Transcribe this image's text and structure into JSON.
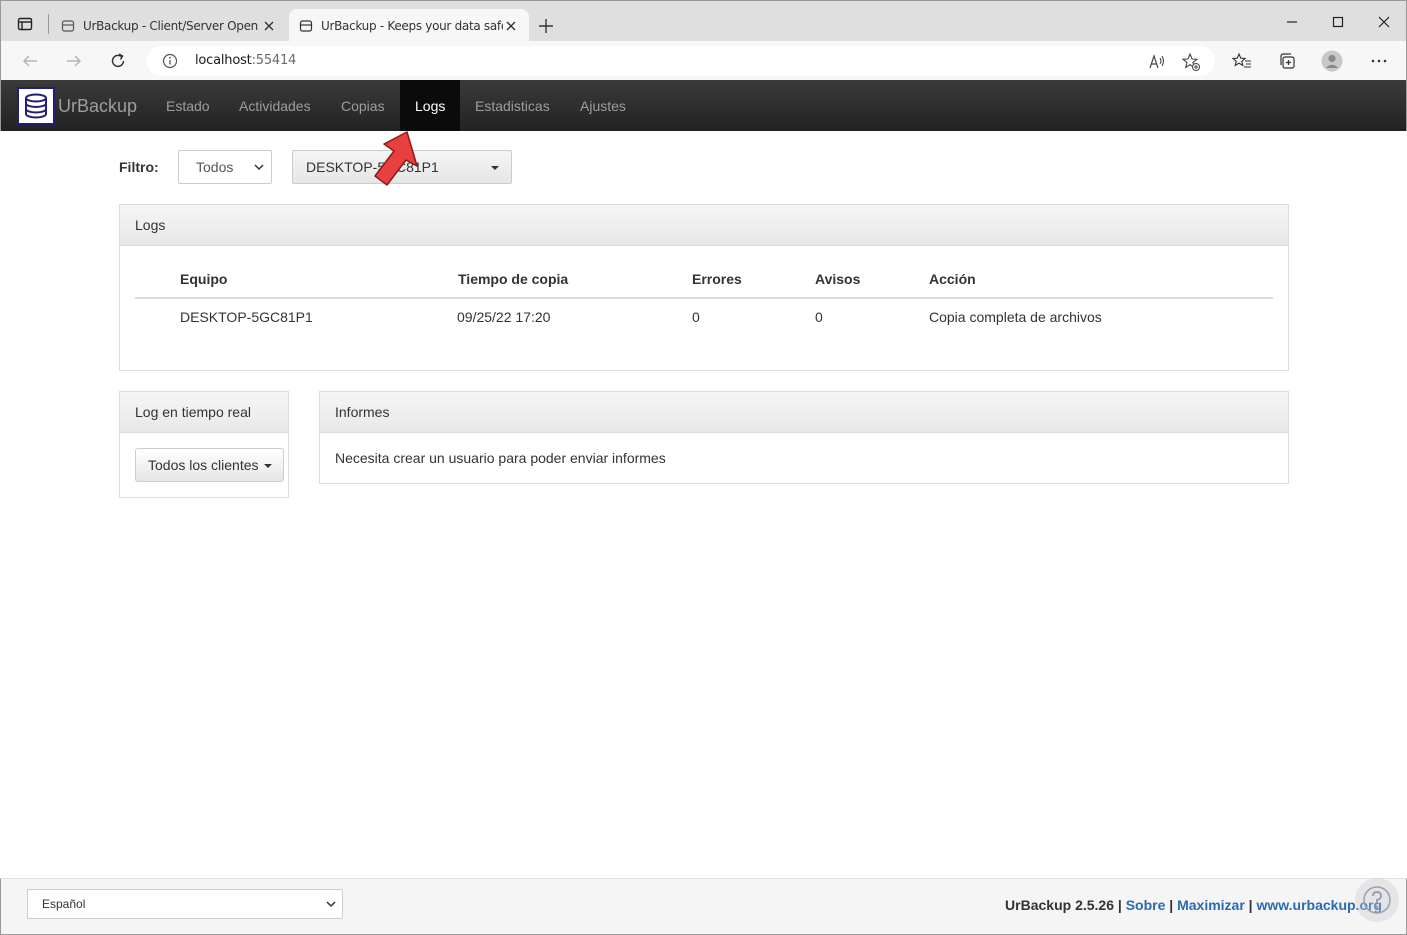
{
  "browser": {
    "tabs": [
      {
        "title": "UrBackup - Client/Server Open S"
      },
      {
        "title": "UrBackup - Keeps your data safe"
      }
    ],
    "url": {
      "host": "localhost",
      "port": ":55414"
    }
  },
  "app": {
    "brand": "UrBackup",
    "nav": [
      {
        "label": "Estado"
      },
      {
        "label": "Actividades"
      },
      {
        "label": "Copias"
      },
      {
        "label": "Logs"
      },
      {
        "label": "Estadisticas"
      },
      {
        "label": "Ajustes"
      }
    ],
    "active_nav": "Logs"
  },
  "filter": {
    "label": "Filtro:",
    "level_value": "Todos",
    "client_value": "DESKTOP-5GC81P1"
  },
  "logs_panel": {
    "title": "Logs",
    "columns": [
      "Equipo",
      "Tiempo de copia",
      "Errores",
      "Avisos",
      "Acción"
    ],
    "rows": [
      {
        "equipo": "DESKTOP-5GC81P1",
        "tiempo": "09/25/22 17:20",
        "errores": "0",
        "avisos": "0",
        "accion": "Copia completa de archivos"
      }
    ]
  },
  "realtime_panel": {
    "title": "Log en tiempo real",
    "button": "Todos los clientes"
  },
  "informes_panel": {
    "title": "Informes",
    "text": "Necesita crear un usuario para poder enviar informes"
  },
  "footer": {
    "language": "Español",
    "version": "UrBackup 2.5.26",
    "sep": " | ",
    "links": [
      "Sobre",
      "Maximizar",
      "www.urbackup.org"
    ]
  },
  "colors": {
    "navbar": "#222222",
    "nav_active": "#0b0b0b",
    "link": "#2a6ab0",
    "pointer": "#e8403e"
  }
}
